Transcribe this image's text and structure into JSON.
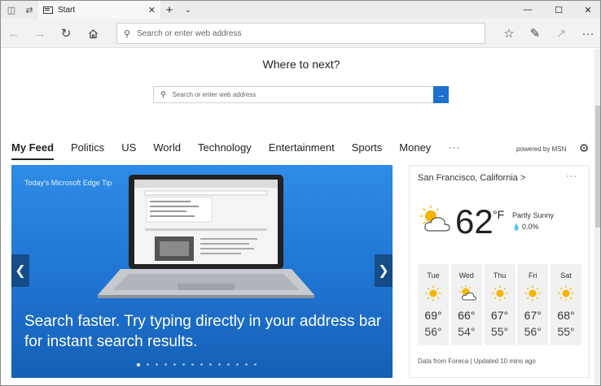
{
  "browser": {
    "tab": {
      "title": "Start"
    },
    "address_bar": {
      "placeholder": "Search or enter web address"
    }
  },
  "page": {
    "heading": "Where to next?",
    "search": {
      "placeholder": "Search or enter web address"
    }
  },
  "feed_nav": {
    "items": [
      "My Feed",
      "Politics",
      "US",
      "World",
      "Technology",
      "Entertainment",
      "Sports",
      "Money"
    ],
    "active": "My Feed",
    "more": "···",
    "powered_by": "powered by MSN"
  },
  "hero": {
    "tip_label": "Today's Microsoft Edge Tip",
    "headline": "Search faster. Try typing directly in your address bar for instant search results.",
    "slide_count": 14,
    "active_slide": 1
  },
  "weather": {
    "location": "San Francisco, California",
    "location_chevron": ">",
    "more": "···",
    "temperature": "62",
    "unit": "°F",
    "condition": "Partly Sunny",
    "precipitation": "0.0%",
    "forecast": [
      {
        "day": "Tue",
        "icon": "sun-icon",
        "high": "69°",
        "low": "56°"
      },
      {
        "day": "Wed",
        "icon": "partly-sunny-icon",
        "high": "66°",
        "low": "54°"
      },
      {
        "day": "Thu",
        "icon": "sun-icon",
        "high": "67°",
        "low": "55°"
      },
      {
        "day": "Fri",
        "icon": "sun-icon",
        "high": "67°",
        "low": "56°"
      },
      {
        "day": "Sat",
        "icon": "sun-icon",
        "high": "68°",
        "low": "55°"
      }
    ],
    "source": "Data from Foreca | Updated 10 mins ago"
  },
  "colors": {
    "accent": "#1e6fce",
    "hero_blue": "#1f74d1",
    "sun": "#f5b400"
  }
}
